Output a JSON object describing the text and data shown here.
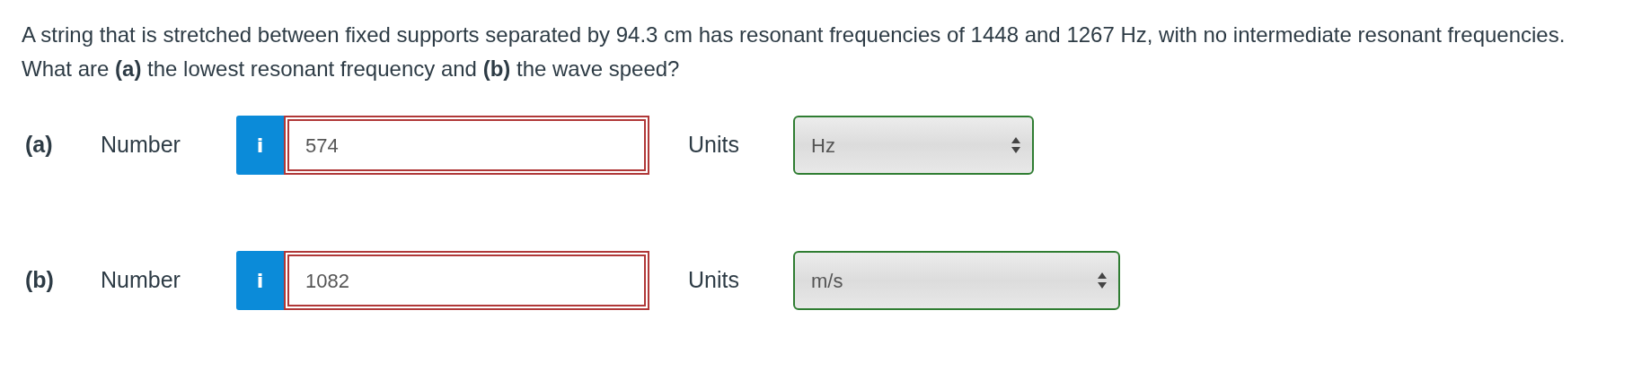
{
  "question": "A string that is stretched between fixed supports separated by 94.3 cm has resonant frequencies of 1448 and 1267 Hz, with no intermediate resonant frequencies. What are **(a)** the lowest resonant frequency and **(b)** the wave speed?",
  "parts": [
    {
      "part_label": "(a)",
      "field_label": "Number",
      "info_button": "i",
      "value": "574",
      "value_correct": false,
      "units_label": "Units",
      "unit": "Hz",
      "unit_correct": true,
      "wide_select": false
    },
    {
      "part_label": "(b)",
      "field_label": "Number",
      "info_button": "i",
      "value": "1082",
      "value_correct": false,
      "units_label": "Units",
      "unit": "m/s",
      "unit_correct": true,
      "wide_select": true
    }
  ]
}
